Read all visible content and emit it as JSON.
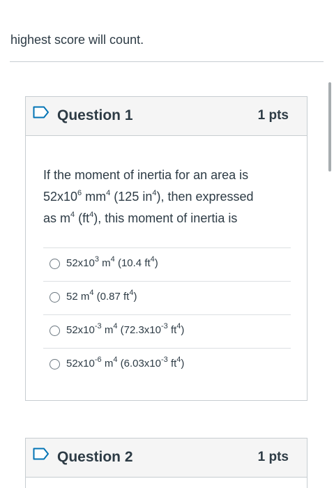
{
  "intro": {
    "text": "highest score will count."
  },
  "questions": [
    {
      "title": "Question 1",
      "points": "1 pts",
      "prompt": {
        "line1": "If the moment of inertia for an area is",
        "line2a": "52x10",
        "line2b": "6",
        "line2c": " mm",
        "line2d": "4",
        "line2e": " (125 in",
        "line2f": "4",
        "line2g": "), then expressed",
        "line3a": "as m",
        "line3b": "4",
        "line3c": " (ft",
        "line3d": "4",
        "line3e": "), this moment of inertia is"
      },
      "answers": [
        {
          "a": "52x10",
          "b": "3",
          "c": " m",
          "d": "4",
          "e": " (10.4 ft",
          "f": "4",
          "g": ")"
        },
        {
          "a": "52  m",
          "b": "4",
          "c": " (0.87 ft",
          "d": "4",
          "e": ")"
        },
        {
          "a": "52x10",
          "b": "-3",
          "c": " m",
          "d": "4",
          "e": " (72.3x10",
          "f": "-3",
          "g": " ft",
          "h": "4",
          "i": ")"
        },
        {
          "a": "52x10",
          "b": "-6",
          "c": " m",
          "d": "4",
          "e": " (6.03x10",
          "f": "-3",
          "g": " ft",
          "h": "4",
          "i": ")"
        }
      ]
    },
    {
      "title": "Question 2",
      "points": "1 pts"
    }
  ],
  "colors": {
    "text": "#2d3b45",
    "header_bg": "#f5f5f5",
    "border": "#c7cdd1",
    "flag": "#0374b5"
  },
  "icons": {
    "flag": "bookmark-flag-icon",
    "radio": "radio-button-icon"
  }
}
